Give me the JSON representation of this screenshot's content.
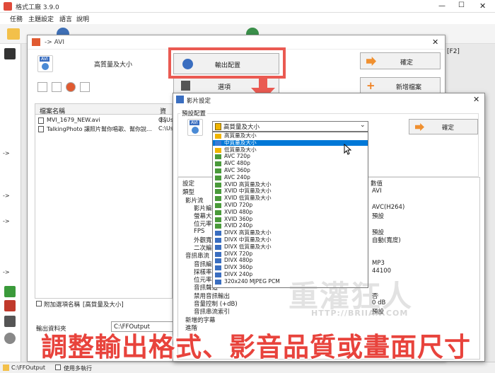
{
  "main_window": {
    "title": "格式工廠 3.9.0",
    "menu": [
      "任務",
      "主題設定",
      "語言",
      "說明"
    ],
    "f2_label": "[F2]",
    "left_arrows": [
      "->",
      "->",
      "->",
      "->",
      "->"
    ],
    "status_path": "C:\\FFOutput",
    "status_multithread": "使用多執行"
  },
  "avi_window": {
    "title": "-> AVI",
    "quality_label": "高質量及大小",
    "output_config_button": "輸出配置",
    "options_button": "選項",
    "ok_button": "確定",
    "add_file_button": "新增檔案",
    "col_filename": "檔案名稱",
    "col_folder": "資料",
    "files": [
      {
        "name": "MVI_1679_NEW.avi",
        "path": "C:\\Us"
      },
      {
        "name": "TalkingPhoto 讓照片幫你唱歌、幫你說...",
        "path": "C:\\Us"
      }
    ],
    "append_option_label": "附加選項名稱",
    "append_option_value": "[高質量及大小]",
    "output_folder_label": "輸出資料夾",
    "output_folder_value": "C:\\FFOutput"
  },
  "settings_dialog": {
    "title": "影片設定",
    "preset_group_label": "預設配置",
    "preset_selected": "高質量及大小",
    "ok_button": "確定",
    "dropdown_items": [
      {
        "label": "高質量及大小",
        "color": "#f0b400"
      },
      {
        "label": "中質量及大小",
        "color": "#3a7bd5",
        "selected": true
      },
      {
        "label": "低質量及大小",
        "color": "#f0b400"
      },
      {
        "label": "AVC 720p",
        "color": "#4a9a3a"
      },
      {
        "label": "AVC 480p",
        "color": "#4a9a3a"
      },
      {
        "label": "AVC 360p",
        "color": "#4a9a3a"
      },
      {
        "label": "AVC 240p",
        "color": "#4a9a3a"
      },
      {
        "label": "XVID 高質量及大小",
        "color": "#4a9a3a"
      },
      {
        "label": "XVID 中質量及大小",
        "color": "#4a9a3a"
      },
      {
        "label": "XVID 低質量及大小",
        "color": "#4a9a3a"
      },
      {
        "label": "XVID 720p",
        "color": "#4a9a3a"
      },
      {
        "label": "XVID 480p",
        "color": "#4a9a3a"
      },
      {
        "label": "XVID 360p",
        "color": "#4a9a3a"
      },
      {
        "label": "XVID 240p",
        "color": "#4a9a3a"
      },
      {
        "label": "DIVX 高質量及大小",
        "color": "#3a6ec0"
      },
      {
        "label": "DIVX 中質量及大小",
        "color": "#3a6ec0"
      },
      {
        "label": "DIVX 低質量及大小",
        "color": "#3a6ec0"
      },
      {
        "label": "DIVX 720p",
        "color": "#3a6ec0"
      },
      {
        "label": "DIVX 480p",
        "color": "#3a6ec0"
      },
      {
        "label": "DIVX 360p",
        "color": "#3a6ec0"
      },
      {
        "label": "DIVX 240p",
        "color": "#3a6ec0"
      },
      {
        "label": "320x240 MJPEG PCM",
        "color": "#3a6ec0"
      }
    ],
    "table_head_setting": "設定",
    "table_head_value": "數值",
    "props_left": [
      "類型",
      "影片流",
      "影片編碼",
      "螢幕大小",
      "位元率",
      "FPS",
      "外觀寬高",
      "二次編碼",
      "音訊串流",
      "音訊編碼",
      "採樣率",
      "位元率",
      "音訊聲道",
      "禁用音訊輸出",
      "音量控制 (+dB)",
      "音訊串流索引",
      "新增的字幕",
      "進階"
    ],
    "props_right": [
      "AVI",
      "",
      "AVC(H264)",
      "預設",
      "",
      "預設",
      "自動(寬度)",
      "",
      "",
      "MP3",
      "44100",
      "",
      "",
      "否",
      "0 dB",
      "預設"
    ]
  },
  "watermark": {
    "text": "重灌狂人",
    "url": "HTTP://BRIIAN.COM"
  },
  "caption": "調整輸出格式、影音品質或畫面尺寸"
}
